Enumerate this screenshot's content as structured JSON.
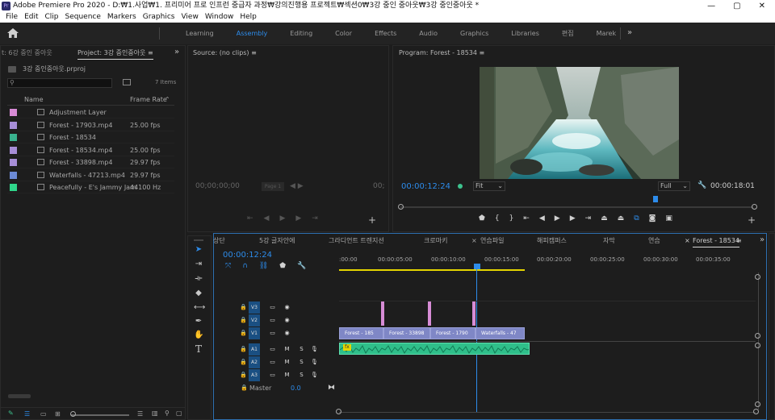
{
  "titlebar": {
    "title": "Adobe Premiere Pro 2020 - D:₩1.사업₩1. 프리미어 프로 인프런 중급자 과정₩강의진행용 프로젝트₩섹션0₩3강 중인 중아웃₩3강 중인중아웃 *",
    "min": "—",
    "max": "▢",
    "close": "✕"
  },
  "menu": [
    "File",
    "Edit",
    "Clip",
    "Sequence",
    "Markers",
    "Graphics",
    "View",
    "Window",
    "Help"
  ],
  "workspaces": {
    "tabs": [
      "Learning",
      "Assembly",
      "Editing",
      "Color",
      "Effects",
      "Audio",
      "Graphics",
      "Libraries",
      "편집",
      "Marek"
    ],
    "active": "Assembly",
    "more": "»"
  },
  "project": {
    "tab_prev": "t: 6강 중인 중아웃",
    "tab_active": "Project: 3강 중인중아웃 ≡",
    "file": "3강 중인중아웃.prproj",
    "item_count": "7 Items",
    "col_name": "Name",
    "col_frame": "Frame Rate",
    "items": [
      {
        "name": "Adjustment Layer",
        "rate": "",
        "color": "#d88bd6"
      },
      {
        "name": "Forest - 17903.mp4",
        "rate": "25.00 fps",
        "color": "#a78ed8"
      },
      {
        "name": "Forest - 18534",
        "rate": "",
        "color": "#39b28e"
      },
      {
        "name": "Forest - 18534.mp4",
        "rate": "25.00 fps",
        "color": "#a78ed8"
      },
      {
        "name": "Forest - 33898.mp4",
        "rate": "29.97 fps",
        "color": "#a78ed8"
      },
      {
        "name": "Waterfalls - 47213.mp4",
        "rate": "29.97 fps",
        "color": "#6c8ad6"
      },
      {
        "name": "Peacefully - E's Jammy Jam",
        "rate": "44100 Hz",
        "color": "#2fd68a"
      }
    ]
  },
  "source": {
    "tab": "Source: (no clips)",
    "menu": "≡",
    "timecode": "00;00;00;00",
    "page": "Page 1",
    "right_tc": "00;"
  },
  "program": {
    "tab": "Program: Forest - 18534",
    "menu": "≡",
    "timecode": "00:00:12:24",
    "fit": "Fit",
    "full": "Full",
    "duration": "00:00:18:01"
  },
  "timeline": {
    "tabs": [
      "상단",
      "5강 글자안에",
      "그라디언트 트렌지션",
      "크로마키",
      "연습파일",
      "해피캠퍼스",
      "자막",
      "연습"
    ],
    "active_tab": "Forest - 18534",
    "timecode": "00:00:12:24",
    "ruler": [
      ":00:00",
      "00:00:05:00",
      "00:00:10:00",
      "00:00:15:00",
      "00:00:20:00",
      "00:00:25:00",
      "00:00:30:00",
      "00:00:35:00"
    ],
    "tracks": [
      {
        "id": "V3",
        "name": "V3",
        "kind": "video"
      },
      {
        "id": "V2",
        "name": "V2",
        "kind": "video"
      },
      {
        "id": "V1",
        "name": "V1",
        "kind": "video"
      },
      {
        "id": "A1",
        "name": "A1",
        "kind": "audio"
      },
      {
        "id": "A2",
        "name": "A2",
        "kind": "audio"
      },
      {
        "id": "A3",
        "name": "A3",
        "kind": "audio"
      }
    ],
    "master_label": "Master",
    "master_value": "0.0",
    "clips": [
      "Forest - 185",
      "Forest - 33898",
      "Forest - 1790",
      "Waterfalls - 47"
    ],
    "audio_fx": "fx"
  },
  "colors": {
    "accent": "#2d8ceb",
    "clip_video": "#7f87c6",
    "clip_audio": "#2fbf8a",
    "marker": "#d78cd6"
  }
}
